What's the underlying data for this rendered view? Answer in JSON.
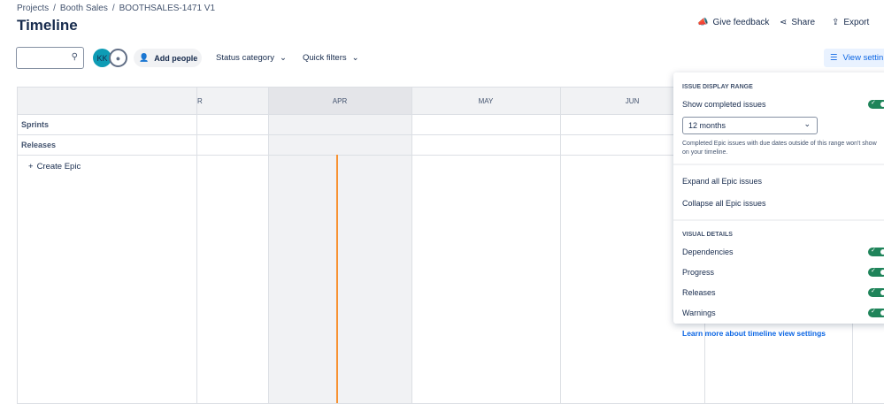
{
  "breadcrumbs": [
    "Projects",
    "/",
    "Booth Sales",
    "/",
    "BOOTHSALES-1471 V1"
  ],
  "header": {
    "title": "Timeline",
    "give_feedback": "Give feedback",
    "share": "Share",
    "export": "Export"
  },
  "toolbar": {
    "search_placeholder": "",
    "avatar_initials": "KK",
    "add_people": "Add people",
    "status_category": "Status category",
    "quick_filters": "Quick filters",
    "view_settings": "View settin"
  },
  "timeline": {
    "months": [
      "R",
      "APR",
      "MAY",
      "JUN"
    ],
    "rows": [
      "Sprints",
      "Releases"
    ],
    "create_epic": "Create Epic"
  },
  "panel": {
    "range_heading": "ISSUE DISPLAY RANGE",
    "show_completed": "Show completed issues",
    "show_completed_on": true,
    "range_value": "12 months",
    "range_note": "Completed Epic issues with due dates outside of this range won't show on your timeline.",
    "expand_all": "Expand all Epic issues",
    "collapse_all": "Collapse all Epic issues",
    "visual_heading": "VISUAL DETAILS",
    "visual": [
      {
        "label": "Dependencies",
        "on": true
      },
      {
        "label": "Progress",
        "on": true
      },
      {
        "label": "Releases",
        "on": true
      },
      {
        "label": "Warnings",
        "on": true
      }
    ],
    "learn_more": "Learn more about timeline view settings"
  },
  "colors": {
    "today": "#f79232",
    "accent": "#0c66e4",
    "toggle": "#1f845a",
    "avatar": "#0e9cb5"
  }
}
